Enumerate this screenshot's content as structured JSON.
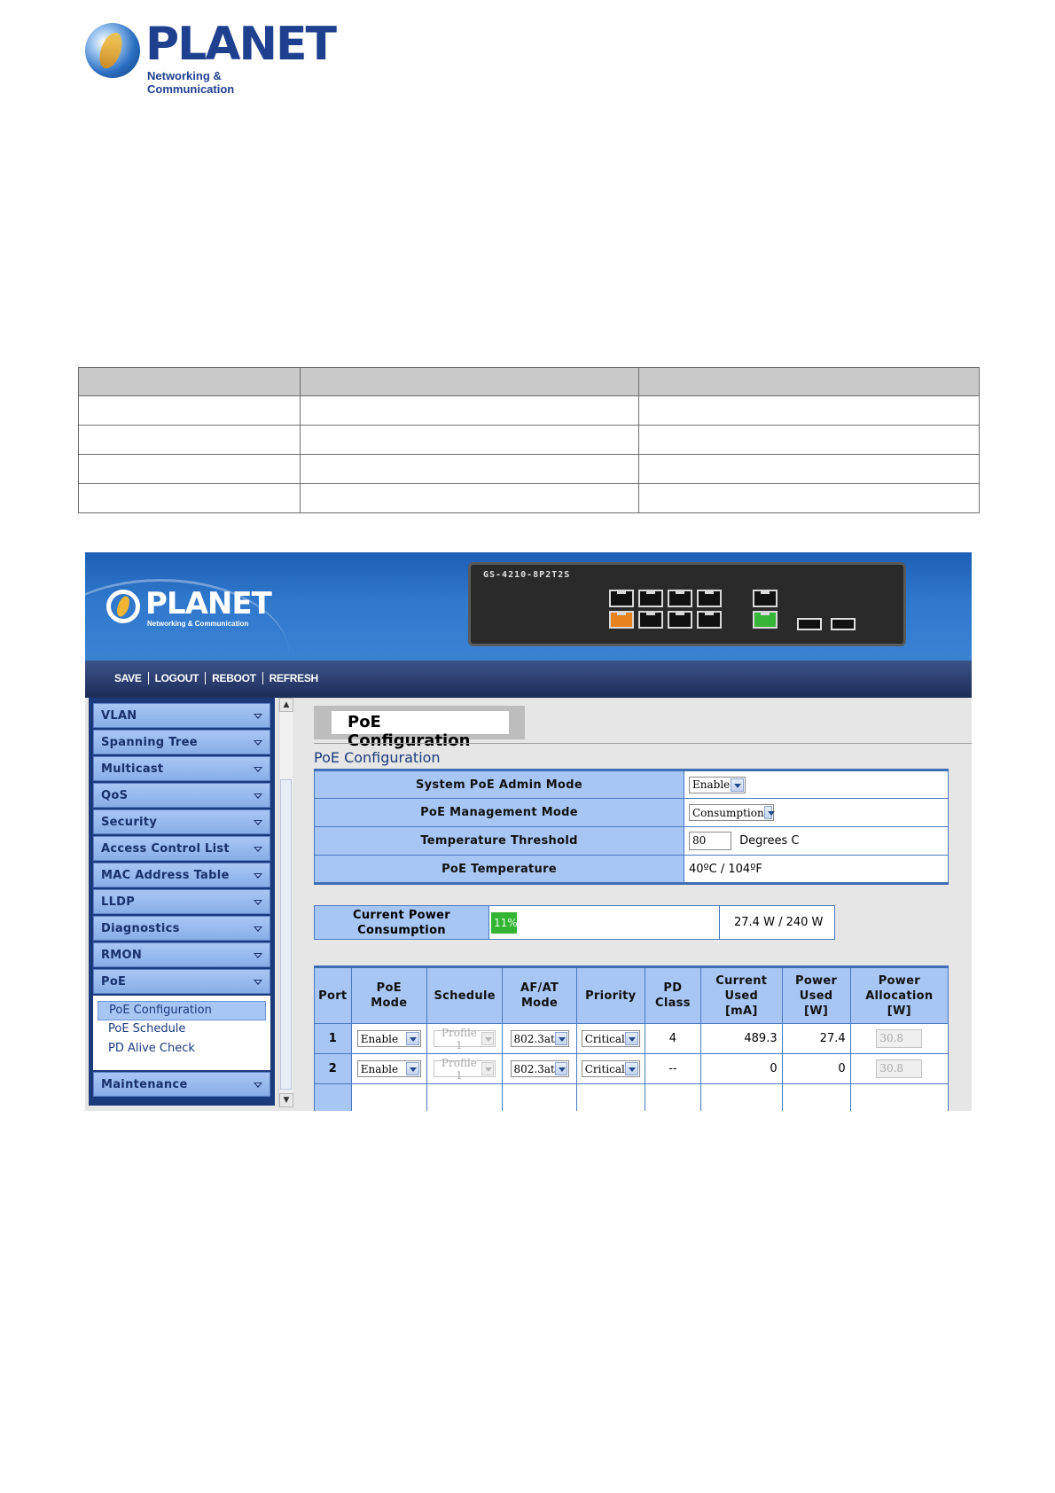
{
  "page_logo": {
    "brand": "PLANET",
    "tagline": "Networking & Communication"
  },
  "doc_table": {
    "header": [
      "",
      "",
      ""
    ],
    "rows": [
      [
        "",
        "",
        ""
      ],
      [
        "",
        "",
        ""
      ],
      [
        "",
        "",
        ""
      ],
      [
        "",
        "",
        ""
      ]
    ]
  },
  "ui": {
    "header": {
      "logo_brand": "PLANET",
      "logo_tagline": "Networking & Communication",
      "device_model": "GS-4210-8P2T2S"
    },
    "menubar": {
      "save": "SAVE",
      "logout": "LOGOUT",
      "reboot": "REBOOT",
      "refresh": "REFRESH"
    },
    "sidebar": {
      "items": [
        "VLAN",
        "Spanning Tree",
        "Multicast",
        "QoS",
        "Security",
        "Access Control List",
        "MAC Address Table",
        "LLDP",
        "Diagnostics",
        "RMON",
        "PoE"
      ],
      "poe_submenu": [
        "PoE Configuration",
        "PoE Schedule",
        "PD Alive Check"
      ],
      "last_item": "Maintenance"
    },
    "content": {
      "page_title": "PoE Configuration",
      "section_title": "PoE Configuration",
      "settings": {
        "admin_mode_label": "System PoE Admin Mode",
        "admin_mode_value": "Enable",
        "mgmt_mode_label": "PoE Management Mode",
        "mgmt_mode_value": "Consumption",
        "temp_threshold_label": "Temperature Threshold",
        "temp_threshold_value": "80",
        "temp_threshold_unit": "Degrees C",
        "poe_temp_label": "PoE Temperature",
        "poe_temp_value": "40ºC / 104ºF"
      },
      "power": {
        "label": "Current Power Consumption",
        "percent_text": "11%",
        "percent": 11,
        "watts": "27.4  W / 240  W"
      },
      "port_table": {
        "headers": {
          "port": "Port",
          "poe_mode": "PoE Mode",
          "schedule": "Schedule",
          "afat_mode": "AF/AT Mode",
          "priority": "Priority",
          "pd_class": "PD Class",
          "current_used": "Current Used [mA]",
          "power_used": "Power Used [W]",
          "power_allocation": "Power Allocation [W]"
        },
        "rows": [
          {
            "port": "1",
            "poe_mode": "Enable",
            "schedule": "Profile 1",
            "afat_mode": "802.3at",
            "priority": "Critical",
            "pd_class": "4",
            "current_used": "489.3",
            "power_used": "27.4",
            "power_allocation": "30.8"
          },
          {
            "port": "2",
            "poe_mode": "Enable",
            "schedule": "Profile 1",
            "afat_mode": "802.3at",
            "priority": "Critical",
            "pd_class": "--",
            "current_used": "0",
            "power_used": "0",
            "power_allocation": "30.8"
          }
        ]
      }
    },
    "colors": {
      "header_blue": "#2f78cc",
      "menubar_navy": "#1d2d58",
      "sidebar_navy": "#1b3a7c",
      "label_blue": "#a8c6f4",
      "power_green": "#33b533"
    }
  }
}
